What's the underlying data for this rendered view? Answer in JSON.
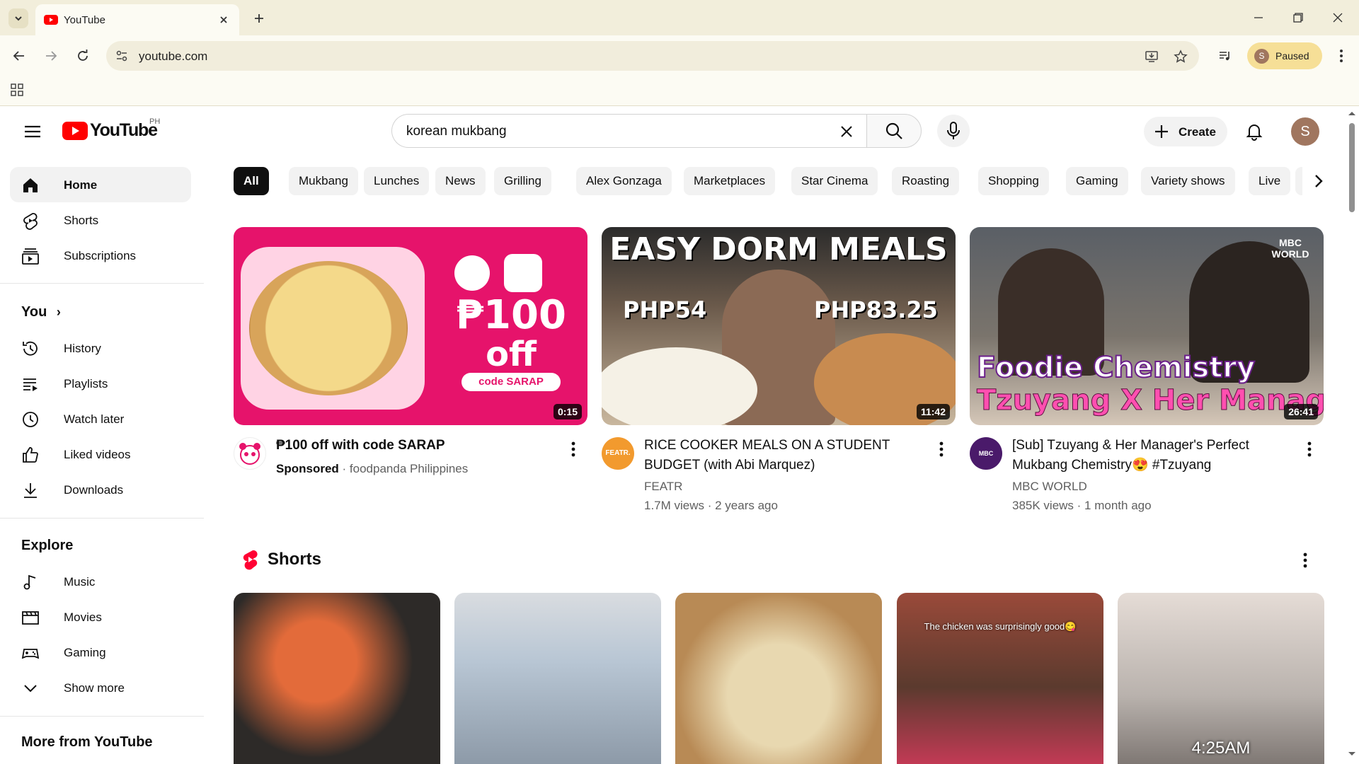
{
  "browser": {
    "tab_title": "YouTube",
    "url": "youtube.com",
    "profile_chip_initial": "S",
    "profile_chip_label": "Paused"
  },
  "masthead": {
    "logo_text": "YouTube",
    "country_code": "PH",
    "search_value": "korean mukbang",
    "create_label": "Create",
    "avatar_initial": "S"
  },
  "sidebar": {
    "main": [
      {
        "label": "Home",
        "icon": "home-icon"
      },
      {
        "label": "Shorts",
        "icon": "shorts-icon"
      },
      {
        "label": "Subscriptions",
        "icon": "subscriptions-icon"
      }
    ],
    "you_heading": "You",
    "you": [
      {
        "label": "History",
        "icon": "history-icon"
      },
      {
        "label": "Playlists",
        "icon": "playlists-icon"
      },
      {
        "label": "Watch later",
        "icon": "watch-later-icon"
      },
      {
        "label": "Liked videos",
        "icon": "thumbs-up-icon"
      },
      {
        "label": "Downloads",
        "icon": "download-icon"
      }
    ],
    "explore_heading": "Explore",
    "explore": [
      {
        "label": "Music",
        "icon": "music-icon"
      },
      {
        "label": "Movies",
        "icon": "movies-icon"
      },
      {
        "label": "Gaming",
        "icon": "gaming-icon"
      },
      {
        "label": "Show more",
        "icon": "chevron-down-icon"
      }
    ],
    "more_heading": "More from YouTube"
  },
  "chips": [
    "All",
    "Mukbang",
    "Lunches",
    "News",
    "Grilling",
    "Alex Gonzaga",
    "Marketplaces",
    "Star Cinema",
    "Roasting",
    "Shopping",
    "Gaming",
    "Variety shows",
    "Live"
  ],
  "videos": [
    {
      "title": "₱100 off with code SARAP",
      "duration": "0:15",
      "sponsored": "Sponsored",
      "channel": "foodpanda Philippines",
      "stats": "",
      "thumb_lines": [
        "₱100",
        "off",
        "code SARAP"
      ]
    },
    {
      "title": "RICE COOKER MEALS ON A STUDENT BUDGET (with Abi Marquez)",
      "duration": "11:42",
      "channel": "FEATR",
      "stats": "1.7M views · 2 years ago",
      "thumb_lines": [
        "EASY DORM MEALS",
        "PHP54",
        "PHP83.25"
      ],
      "avatar_text": "FEATR."
    },
    {
      "title": "[Sub] Tzuyang & Her Manager's Perfect Mukbang Chemistry😍 #Tzuyang",
      "duration": "26:41",
      "channel": "MBC WORLD",
      "stats": "385K views · 1 month ago",
      "thumb_lines": [
        "Foodie Chemistry",
        "Tzuyang X Her Manager",
        "MBC WORLD"
      ],
      "avatar_text": "MBC WORLD"
    }
  ],
  "shorts": {
    "heading": "Shorts",
    "items": [
      {
        "overlay": "",
        "time": ""
      },
      {
        "overlay": "",
        "time": ""
      },
      {
        "overlay": "",
        "time": ""
      },
      {
        "overlay": "The chicken was surprisingly good😋",
        "time": ""
      },
      {
        "overlay": "",
        "time": "4:25AM"
      }
    ]
  },
  "colors": {
    "brand_red": "#ff0000",
    "chrome_bg": "#f2eedb",
    "chip_active": "#0f0f0f",
    "sponsor_pink": "#e6136b"
  }
}
